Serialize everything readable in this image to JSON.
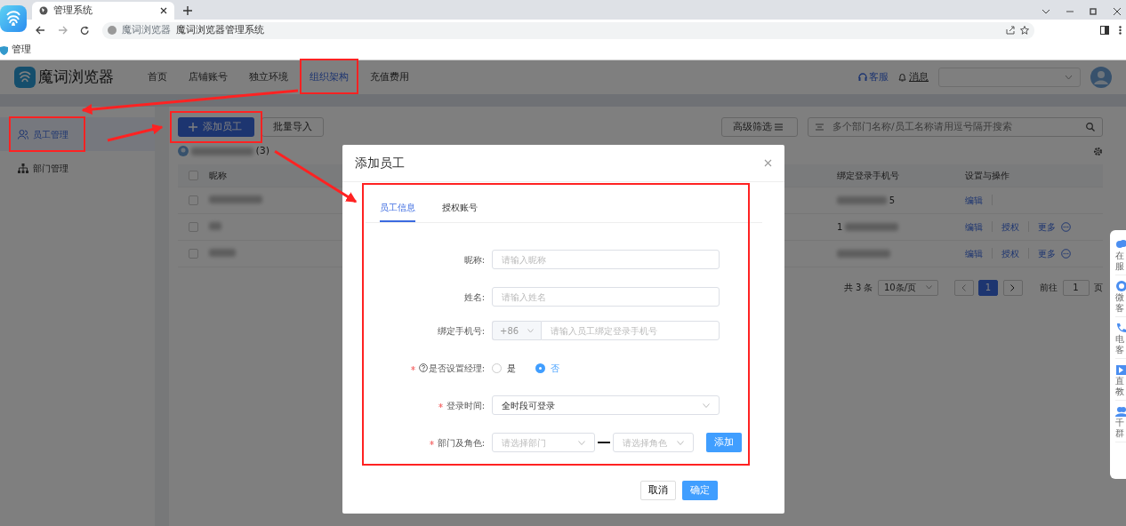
{
  "browser": {
    "tab_title": "管理系统",
    "site_chip": "魔词浏览器",
    "url": "魔词浏览器管理系统",
    "bookmark": "管理"
  },
  "app": {
    "logo": "魔词浏览器",
    "support": "客服",
    "messages": "消息"
  },
  "nav": [
    {
      "label": "首页",
      "selected": false
    },
    {
      "label": "店铺账号",
      "selected": false
    },
    {
      "label": "独立环境",
      "selected": false
    },
    {
      "label": "组织架构",
      "selected": true
    },
    {
      "label": "充值费用",
      "selected": false
    }
  ],
  "sidebar": {
    "items": [
      {
        "label": "员工管理",
        "selected": true,
        "kind": "people"
      },
      {
        "label": "部门管理",
        "selected": false,
        "kind": "tree"
      }
    ]
  },
  "toolbar": {
    "add_button": "添加员工",
    "import_button": "批量导入",
    "filter_button": "高级筛选",
    "search_placeholder": "多个部门名称/员工名称请用逗号隔开搜索"
  },
  "org_count": "(3)",
  "table": {
    "columns": [
      "昵称",
      "绑定登录手机号",
      "设置与操作"
    ],
    "select_all_checked": false,
    "rows": [
      {
        "checked": false,
        "phone": "5",
        "actions": [
          "编辑"
        ]
      },
      {
        "checked": false,
        "phone": "1",
        "actions": [
          "编辑",
          "授权",
          "更多"
        ]
      },
      {
        "checked": false,
        "actions": [
          "编辑",
          "授权",
          "更多"
        ]
      }
    ]
  },
  "pagination": {
    "total": "共 3 条",
    "page_size": "10条/页",
    "pages": [
      {
        "label": "1",
        "selected": true
      }
    ],
    "goto_label": "前往",
    "goto_value": "1",
    "page_suffix": "页"
  },
  "dialog": {
    "title": "添加员工",
    "tabs": [
      {
        "label": "员工信息",
        "selected": true
      },
      {
        "label": "授权账号",
        "selected": false
      }
    ],
    "fields": [
      {
        "kind": "text",
        "label": "昵称:",
        "required": false,
        "placeholder": "请输入昵称"
      },
      {
        "kind": "text",
        "label": "姓名:",
        "required": false,
        "placeholder": "请输入姓名"
      },
      {
        "kind": "phone",
        "label": "绑定手机号:",
        "required": false,
        "prefix": "+86",
        "placeholder": "请输入员工绑定登录手机号"
      },
      {
        "kind": "radio",
        "label": "是否设置经理:",
        "required": true,
        "help": true,
        "options": [
          {
            "label": "是",
            "selected": false
          },
          {
            "label": "否",
            "selected": true
          }
        ]
      },
      {
        "kind": "select",
        "label": "登录时间:",
        "required": true,
        "value": "全时段可登录"
      },
      {
        "kind": "pair",
        "label": "部门及角色:",
        "required": true,
        "placeholders": [
          "请选择部门",
          "请选择角色"
        ],
        "button": "添加"
      }
    ],
    "cancel": "取消",
    "confirm": "确定"
  },
  "side_panel": {
    "items": [
      {
        "kind": "cloud",
        "lines": [
          "在",
          "服"
        ]
      },
      {
        "kind": "chat",
        "lines": [
          "微",
          "客"
        ]
      },
      {
        "kind": "phone",
        "lines": [
          "电",
          "客"
        ]
      },
      {
        "kind": "play",
        "lines": [
          "直",
          "教"
        ]
      },
      {
        "kind": "group",
        "lines": [
          "千",
          "群"
        ]
      }
    ]
  }
}
